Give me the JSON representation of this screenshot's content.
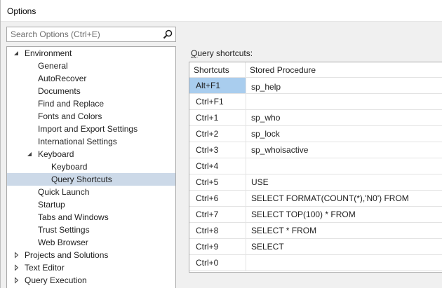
{
  "window": {
    "title": "Options"
  },
  "search": {
    "placeholder": "Search Options (Ctrl+E)",
    "icon": "search-icon"
  },
  "tree": {
    "items": [
      {
        "label": "Environment",
        "level": 0,
        "toggle": "expanded"
      },
      {
        "label": "General",
        "level": 1
      },
      {
        "label": "AutoRecover",
        "level": 1
      },
      {
        "label": "Documents",
        "level": 1
      },
      {
        "label": "Find and Replace",
        "level": 1
      },
      {
        "label": "Fonts and Colors",
        "level": 1
      },
      {
        "label": "Import and Export Settings",
        "level": 1
      },
      {
        "label": "International Settings",
        "level": 1
      },
      {
        "label": "Keyboard",
        "level": 1,
        "toggle": "expanded"
      },
      {
        "label": "Keyboard",
        "level": 2
      },
      {
        "label": "Query Shortcuts",
        "level": 2,
        "selected": true
      },
      {
        "label": "Quick Launch",
        "level": 1
      },
      {
        "label": "Startup",
        "level": 1
      },
      {
        "label": "Tabs and Windows",
        "level": 1
      },
      {
        "label": "Trust Settings",
        "level": 1
      },
      {
        "label": "Web Browser",
        "level": 1
      },
      {
        "label": "Projects and Solutions",
        "level": 0,
        "toggle": "collapsed"
      },
      {
        "label": "Text Editor",
        "level": 0,
        "toggle": "collapsed"
      },
      {
        "label": "Query Execution",
        "level": 0,
        "toggle": "collapsed"
      }
    ]
  },
  "query_shortcuts": {
    "title_mnemonic": "Q",
    "title_rest": "uery shortcuts:",
    "columns": [
      "Shortcuts",
      "Stored Procedure"
    ],
    "rows": [
      {
        "shortcut": "Alt+F1",
        "procedure": "sp_help",
        "selected": true
      },
      {
        "shortcut": "Ctrl+F1",
        "procedure": ""
      },
      {
        "shortcut": "Ctrl+1",
        "procedure": "sp_who"
      },
      {
        "shortcut": "Ctrl+2",
        "procedure": "sp_lock"
      },
      {
        "shortcut": "Ctrl+3",
        "procedure": "sp_whoisactive"
      },
      {
        "shortcut": "Ctrl+4",
        "procedure": ""
      },
      {
        "shortcut": "Ctrl+5",
        "procedure": "USE"
      },
      {
        "shortcut": "Ctrl+6",
        "procedure": "SELECT FORMAT(COUNT(*),'N0') FROM"
      },
      {
        "shortcut": "Ctrl+7",
        "procedure": "SELECT TOP(100) * FROM"
      },
      {
        "shortcut": "Ctrl+8",
        "procedure": "SELECT * FROM"
      },
      {
        "shortcut": "Ctrl+9",
        "procedure": "SELECT"
      },
      {
        "shortcut": "Ctrl+0",
        "procedure": ""
      }
    ]
  },
  "colors": {
    "tree_selected": "#ccd9e8",
    "row_selected": "#a9cdee",
    "border": "#a9a9a9"
  }
}
